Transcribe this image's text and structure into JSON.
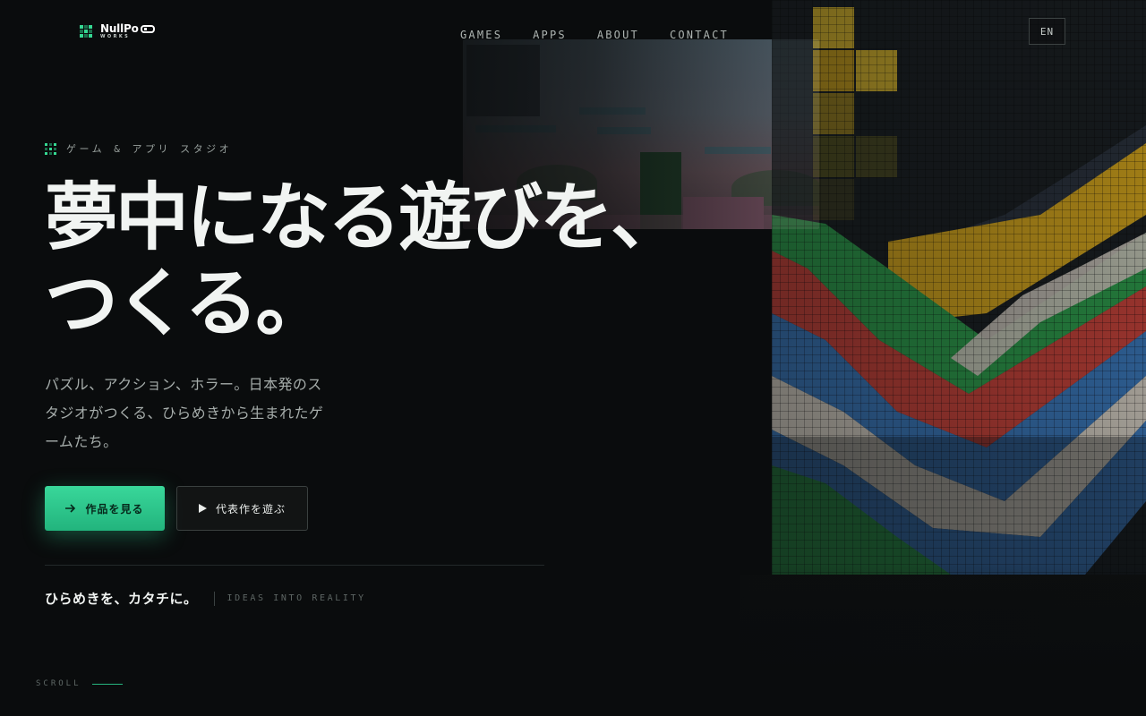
{
  "brand": {
    "name": "NullPo",
    "sub": "WORKS"
  },
  "nav": {
    "items": [
      "GAMES",
      "APPS",
      "ABOUT",
      "CONTACT"
    ],
    "lang": "EN"
  },
  "hero": {
    "eyebrow": "ゲーム & アプリ スタジオ",
    "headline_line1": "夢中になる遊びを、",
    "headline_line2": "つくる。",
    "lead": "パズル、アクション、ホラー。日本発のスタジオがつくる、ひらめきから生まれたゲームたち。",
    "primary_button": "作品を見る",
    "secondary_button": "代表作を遊ぶ",
    "tagline_jp": "ひらめきを、カタチに。",
    "tagline_en": "IDEAS INTO REALITY"
  },
  "scroll": "SCROLL",
  "colors": {
    "accent": "#2fd08f",
    "background": "#0a0c0d",
    "text": "#f1f4f2",
    "muted": "#a5acaa"
  },
  "icons": {
    "primary_button": "arrow-right-icon",
    "secondary_button": "play-icon",
    "brand": "gamepad-icon"
  }
}
